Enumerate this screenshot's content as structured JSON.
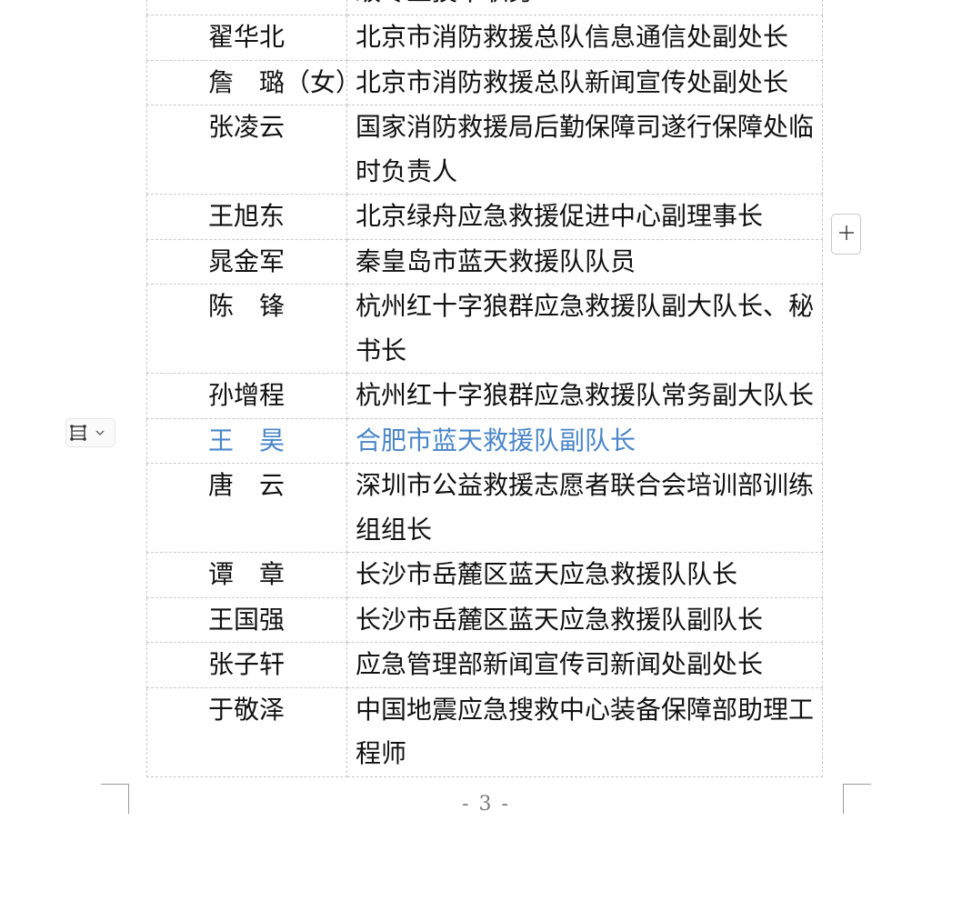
{
  "table": {
    "top_partial_text": "级专业技术职务",
    "rows": [
      {
        "name": "翟华北",
        "role": "北京市消防救援总队信息通信处副处长"
      },
      {
        "name": "詹　璐（女）",
        "role": "北京市消防救援总队新闻宣传处副处长"
      },
      {
        "name": "张凌云",
        "role": "国家消防救援局后勤保障司遂行保障处临时负责人"
      },
      {
        "name": "王旭东",
        "role": "北京绿舟应急救援促进中心副理事长"
      },
      {
        "name": "晁金军",
        "role": "秦皇岛市蓝天救援队队员"
      },
      {
        "name": "陈　锋",
        "role": "杭州红十字狼群应急救援队副大队长、秘书长"
      },
      {
        "name": "孙增程",
        "role": "杭州红十字狼群应急救援队常务副大队长"
      },
      {
        "name": "王　昊",
        "role": "合肥市蓝天救援队副队长"
      },
      {
        "name": "唐　云",
        "role": "深圳市公益救援志愿者联合会培训部训练组组长"
      },
      {
        "name": "谭　章",
        "role": "长沙市岳麓区蓝天应急救援队队长"
      },
      {
        "name": "王国强",
        "role": "长沙市岳麓区蓝天应急救援队副队长"
      },
      {
        "name": "张子轩",
        "role": "应急管理部新闻宣传司新闻处副处长"
      },
      {
        "name": "于敬泽",
        "role": "中国地震应急搜救中心装备保障部助理工程师"
      }
    ]
  },
  "page_number": "- 3 -",
  "icons": {
    "row_handle": "table-grip-icon",
    "row_menu": "chevron-down-icon",
    "add_column": "plus-icon"
  },
  "colors": {
    "selected_row_text": "#4a86c8",
    "table_border": "#c9c9c9"
  }
}
